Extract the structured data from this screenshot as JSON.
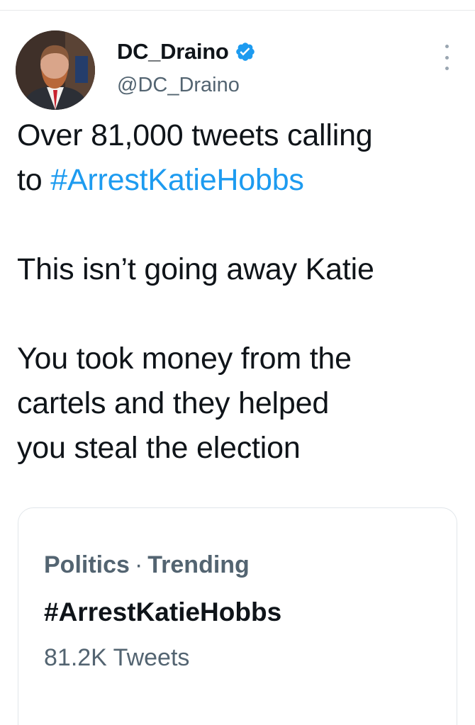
{
  "author": {
    "display_name": "DC_Draino",
    "handle": "@DC_Draino",
    "verified": true,
    "verified_color": "#1d9bf0"
  },
  "tweet": {
    "line_1": "Over 81,000 tweets calling",
    "line_2_prefix": "to ",
    "hashtag": "#ArrestKatieHobbs",
    "line_3": "This isn’t going away Katie",
    "line_4": "You took money from the",
    "line_5": "cartels and they helped",
    "line_6": "you steal the election",
    "hashtag_color": "#1d9bf0"
  },
  "trend_card": {
    "category": "Politics",
    "separator": "·",
    "status": "Trending",
    "hashtag": "#ArrestKatieHobbs",
    "count": "81.2K Tweets"
  },
  "icons": {
    "verified": "verified-badge-icon",
    "more": "more-options-icon",
    "avatar": "profile-avatar"
  }
}
